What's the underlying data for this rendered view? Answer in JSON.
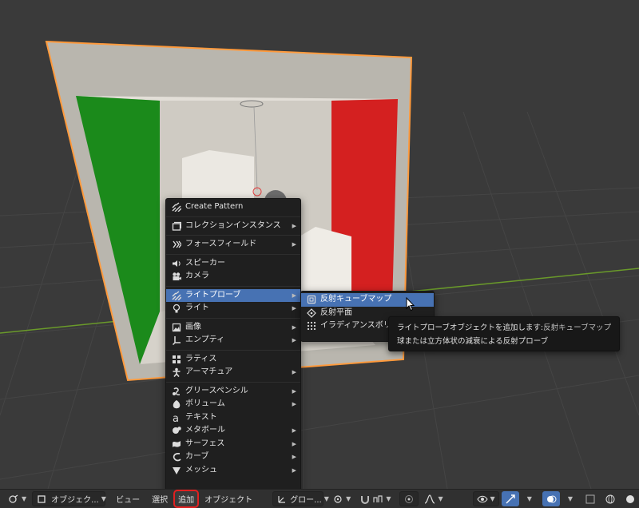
{
  "add_menu": {
    "items": [
      {
        "label": "Create Pattern",
        "icon": "pattern-icon",
        "submenu": false
      },
      {
        "label": "コレクションインスタンス",
        "icon": "collection-icon",
        "submenu": true
      },
      {
        "label": "フォースフィールド",
        "icon": "forcefield-icon",
        "submenu": true
      },
      {
        "label": "スピーカー",
        "icon": "speaker-icon",
        "submenu": false
      },
      {
        "label": "カメラ",
        "icon": "camera-icon",
        "submenu": false
      },
      {
        "label": "ライトプローブ",
        "icon": "lightprobe-icon",
        "submenu": true
      },
      {
        "label": "ライト",
        "icon": "light-icon",
        "submenu": true
      },
      {
        "label": "画像",
        "icon": "image-icon",
        "submenu": true
      },
      {
        "label": "エンプティ",
        "icon": "empty-icon",
        "submenu": true
      },
      {
        "label": "ラティス",
        "icon": "lattice-icon",
        "submenu": false
      },
      {
        "label": "アーマチュア",
        "icon": "armature-icon",
        "submenu": true
      },
      {
        "label": "グリースペンシル",
        "icon": "grease-pencil-icon",
        "submenu": true
      },
      {
        "label": "ボリューム",
        "icon": "volume-icon",
        "submenu": true
      },
      {
        "label": "テキスト",
        "icon": "text-icon",
        "submenu": false
      },
      {
        "label": "メタボール",
        "icon": "metaball-icon",
        "submenu": true
      },
      {
        "label": "サーフェス",
        "icon": "surface-icon",
        "submenu": true
      },
      {
        "label": "カーブ",
        "icon": "curve-icon",
        "submenu": true
      },
      {
        "label": "メッシュ",
        "icon": "mesh-icon",
        "submenu": true
      }
    ]
  },
  "lightprobe_submenu": {
    "items": [
      {
        "label": "反射キューブマップ",
        "icon": "cubemap-icon"
      },
      {
        "label": "反射平面",
        "icon": "plane-probe-icon"
      },
      {
        "label": "イラディアンスボリ",
        "icon": "grid-probe-icon"
      }
    ]
  },
  "tooltip": {
    "line1": "ライトプローブオブジェクトを追加します:",
    "line1_item": "反射キューブマップ",
    "line2": "球または立方体状の減衰による反射プローブ"
  },
  "header": {
    "mode": "オブジェク...",
    "view": "ビュー",
    "select": "選択",
    "add": "追加",
    "object": "オブジェクト",
    "orientation": "グロー..."
  },
  "colors": {
    "menu_bg": "#1f1f1f",
    "highlight": "#4772b3",
    "header_bg": "#303030",
    "add_outline": "#e02020",
    "wall_green": "#1b8a1b",
    "wall_red": "#d42020",
    "selection_orange": "#ff9a3c"
  }
}
